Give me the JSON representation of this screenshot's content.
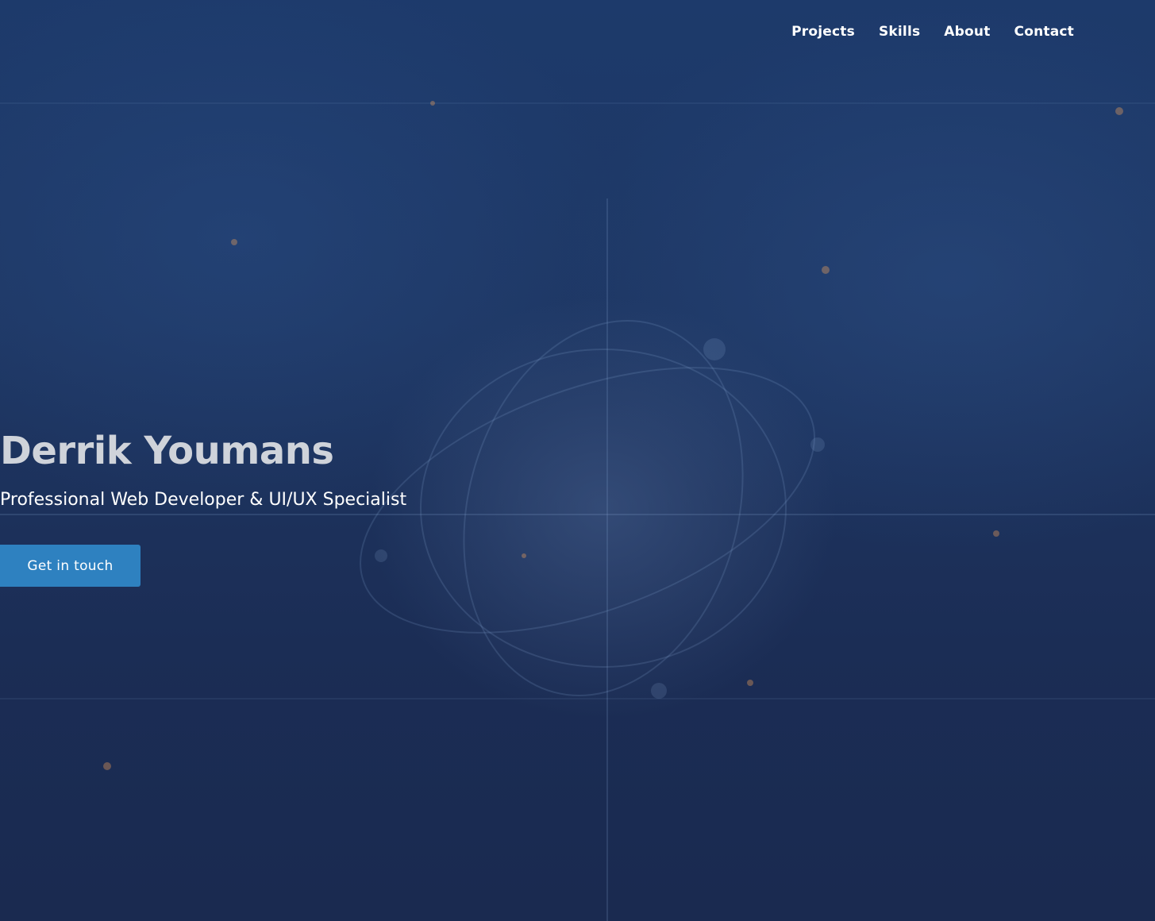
{
  "nav": {
    "items": [
      {
        "label": "Projects"
      },
      {
        "label": "Skills"
      },
      {
        "label": "About"
      },
      {
        "label": "Contact"
      }
    ]
  },
  "hero": {
    "title": "Derrik Youmans",
    "subtitle": "Professional Web Developer & UI/UX Specialist",
    "cta_label": "Get in touch"
  },
  "colors": {
    "background": "#1d3560",
    "accent_button": "#2e81c0",
    "title_text": "#cfd3da",
    "nav_text": "#ffffff"
  }
}
